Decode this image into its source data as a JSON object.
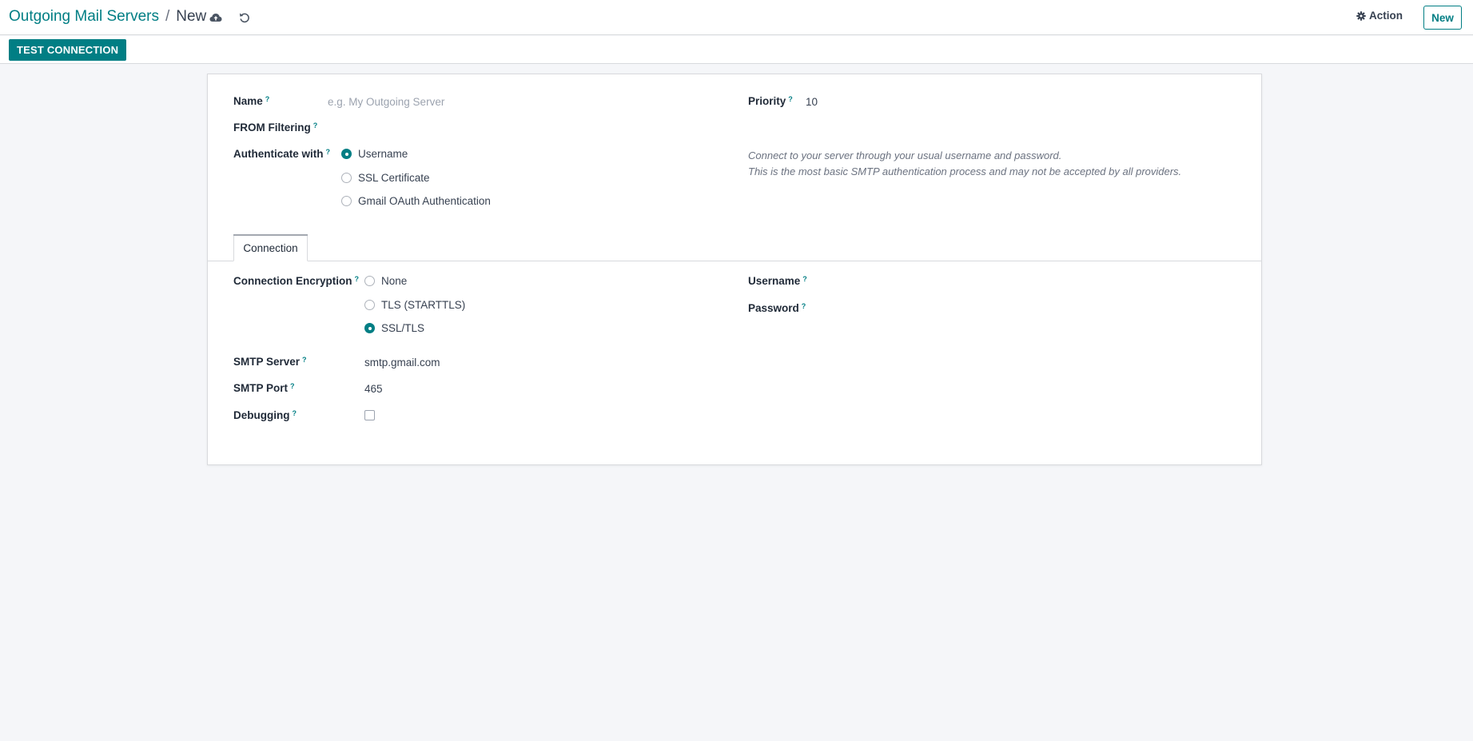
{
  "header": {
    "breadcrumb_parent": "Outgoing Mail Servers",
    "breadcrumb_separator": "/",
    "breadcrumb_current": "New",
    "action_label": "Action",
    "new_label": "New"
  },
  "statusbar": {
    "test_connection_label": "TEST CONNECTION"
  },
  "form": {
    "name": {
      "label": "Name",
      "tip": "?",
      "placeholder": "e.g. My Outgoing Server",
      "value": ""
    },
    "from_filtering": {
      "label": "FROM Filtering",
      "tip": "?"
    },
    "priority": {
      "label": "Priority",
      "tip": "?",
      "value": "10"
    },
    "authenticate": {
      "label": "Authenticate with",
      "tip": "?",
      "options": [
        "Username",
        "SSL Certificate",
        "Gmail OAuth Authentication"
      ],
      "selected": "Username"
    },
    "help_lines": [
      "Connect to your server through your usual username and password.",
      "This is the most basic SMTP authentication process and may not be accepted by all providers."
    ]
  },
  "tabs": [
    {
      "label": "Connection",
      "active": true
    }
  ],
  "connection": {
    "encryption": {
      "label": "Connection Encryption",
      "tip": "?",
      "options": [
        "None",
        "TLS (STARTTLS)",
        "SSL/TLS"
      ],
      "selected": "SSL/TLS"
    },
    "smtp_server": {
      "label": "SMTP Server",
      "tip": "?",
      "value": "smtp.gmail.com"
    },
    "smtp_port": {
      "label": "SMTP Port",
      "tip": "?",
      "value": "465"
    },
    "debugging": {
      "label": "Debugging",
      "tip": "?",
      "checked": false
    },
    "username": {
      "label": "Username",
      "tip": "?",
      "value": ""
    },
    "password": {
      "label": "Password",
      "tip": "?",
      "value": ""
    }
  },
  "colors": {
    "accent": "#017e84",
    "background": "#f5f6f9",
    "text": "#374151"
  },
  "icons": [
    "cloud-upload-icon",
    "undo-icon",
    "gear-icon"
  ]
}
